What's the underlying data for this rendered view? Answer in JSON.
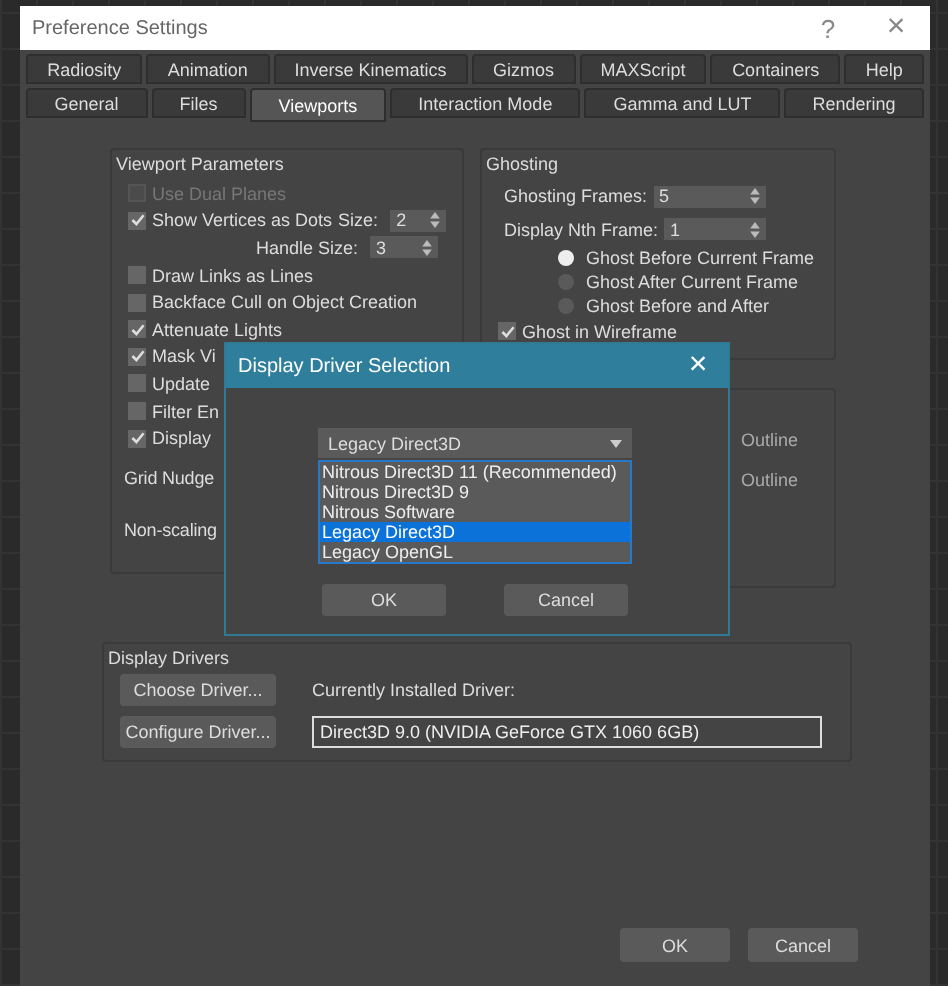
{
  "window": {
    "title": "Preference Settings",
    "help": "?",
    "close": "×"
  },
  "tabs_top": [
    {
      "label": "Radiosity",
      "selected": false
    },
    {
      "label": "Animation",
      "selected": false
    },
    {
      "label": "Inverse Kinematics",
      "selected": false
    },
    {
      "label": "Gizmos",
      "selected": false
    },
    {
      "label": "MAXScript",
      "selected": false
    },
    {
      "label": "Containers",
      "selected": false
    },
    {
      "label": "Help",
      "selected": false
    }
  ],
  "tabs_bottom": [
    {
      "label": "General",
      "selected": false
    },
    {
      "label": "Files",
      "selected": false
    },
    {
      "label": "Viewports",
      "selected": true
    },
    {
      "label": "Interaction Mode",
      "selected": false
    },
    {
      "label": "Gamma and LUT",
      "selected": false
    },
    {
      "label": "Rendering",
      "selected": false
    }
  ],
  "viewport_parameters": {
    "title": "Viewport Parameters",
    "rows": [
      {
        "kind": "checkbox",
        "label": "Use Dual Planes",
        "checked": false,
        "disabled": true
      },
      {
        "kind": "checkbox-spinner",
        "label": "Show Vertices as Dots",
        "checked": true,
        "disabled": false,
        "spinner_label": "Size:",
        "value": "2"
      },
      {
        "kind": "spinner",
        "label": "Handle Size:",
        "value": "3"
      },
      {
        "kind": "checkbox",
        "label": "Draw Links as Lines",
        "checked": false,
        "disabled": false
      },
      {
        "kind": "checkbox",
        "label": "Backface Cull on Object Creation",
        "checked": false,
        "disabled": false
      },
      {
        "kind": "checkbox",
        "label": "Attenuate Lights",
        "checked": true,
        "disabled": false
      },
      {
        "kind": "checkbox",
        "label": "Mask Vi",
        "checked": true,
        "disabled": false
      },
      {
        "kind": "checkbox",
        "label": "Update",
        "checked": false,
        "disabled": false
      },
      {
        "kind": "checkbox",
        "label": "Filter En",
        "checked": false,
        "disabled": false
      },
      {
        "kind": "checkbox",
        "label": "Display",
        "checked": true,
        "disabled": false
      },
      {
        "kind": "text",
        "label": "Grid Nudge"
      },
      {
        "kind": "text",
        "label": "Non-scaling"
      }
    ]
  },
  "ghosting": {
    "title": "Ghosting",
    "spinners": [
      {
        "label": "Ghosting Frames:",
        "value": "5"
      },
      {
        "label": "Display Nth Frame:",
        "value": "1"
      }
    ],
    "radios": [
      {
        "label": "Ghost Before Current Frame",
        "selected": true
      },
      {
        "label": "Ghost After Current Frame",
        "selected": false
      },
      {
        "label": "Ghost Before and After",
        "selected": false
      }
    ],
    "checkbox": {
      "label": "Ghost in Wireframe",
      "checked": true
    }
  },
  "group_3": {
    "items": [
      "Outline",
      "Outline"
    ]
  },
  "display_drivers": {
    "title": "Display Drivers",
    "buttons": [
      "Choose Driver...",
      "Configure Driver..."
    ],
    "installed_label": "Currently Installed Driver:",
    "installed_value": "Direct3D 9.0 (NVIDIA GeForce GTX 1060 6GB)"
  },
  "buttons": [
    "OK",
    "Cancel"
  ],
  "modal": {
    "title": "Display Driver Selection",
    "close": "×",
    "dropdown": {
      "value": "Legacy Direct3D",
      "options": [
        {
          "label": "Nitrous Direct3D 11 (Recommended)",
          "selected": false
        },
        {
          "label": "Nitrous Direct3D 9",
          "selected": false
        },
        {
          "label": "Nitrous Software",
          "selected": false
        },
        {
          "label": "Legacy Direct3D",
          "selected": true
        },
        {
          "label": "Legacy OpenGL",
          "selected": false
        }
      ]
    },
    "buttons": [
      "OK",
      "Cancel"
    ]
  }
}
